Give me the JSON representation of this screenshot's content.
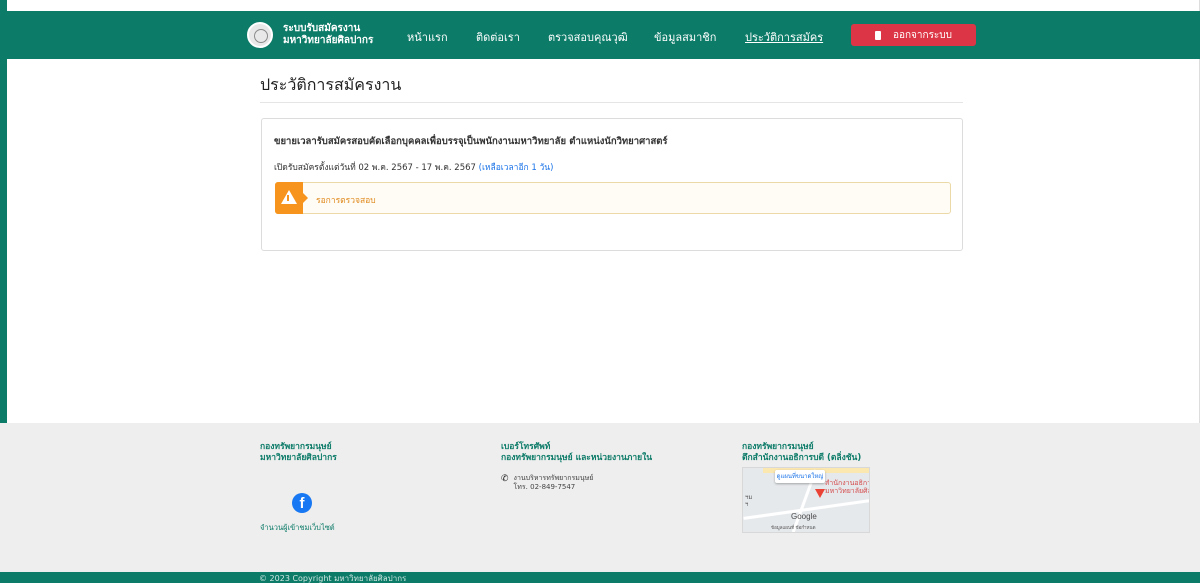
{
  "navbar": {
    "brand_line1": "ระบบรับสมัครงาน",
    "brand_line2": "มหาวิทยาลัยศิลปากร",
    "links": [
      "หน้าแรก",
      "ติดต่อเรา",
      "ตรวจสอบคุณวุฒิ",
      "ข้อมูลสมาชิก",
      "ประวัติการสมัคร"
    ],
    "active_link": "ประวัติการสมัคร",
    "logout_label": "ออกจากระบบ"
  },
  "main": {
    "page_title": "ประวัติการสมัครงาน",
    "application": {
      "title": "ขยายเวลารับสมัครสอบคัดเลือกบุคคลเพื่อบรรจุเป็นพนักงานมหาวิทยาลัย ตำแหน่งนักวิทยาศาสตร์",
      "date_text": "เปิดรับสมัครตั้งแต่วันที่ 02 พ.ค. 2567 - 17 พ.ค. 2567",
      "remaining": "(เหลือเวลาอีก 1 วัน)",
      "status": "รอการตรวจสอบ"
    }
  },
  "footer": {
    "col1": {
      "heading_line1": "กองทรัพยากรมนุษย์",
      "heading_line2": "มหาวิทยาลัยศิลปากร",
      "facebook_icon": "facebook-icon",
      "visitor_label": "จำนวนผู้เข้าชมเว็บไซต์"
    },
    "col2": {
      "heading_line1": "เบอร์โทรศัพท์",
      "heading_line2": "กองทรัพยากรมนุษย์ และหน่วยงานภายใน",
      "phone_name": "งานบริหารทรัพยากรมนุษย์",
      "phone_number": "โทร. 02-849-7547"
    },
    "col3": {
      "heading_line1": "กองทรัพยากรมนุษย์",
      "heading_line2": "ตึกสำนักงานอธิการบดี (ตลิ่งชัน)",
      "map_button": "ดูแผนที่ขนาดใหญ่",
      "map_place": "สำนักงานอธิการ",
      "map_place2": "มหาวิทยาลัยศิล",
      "map_brand": "Google",
      "map_footer": "ข้อมูลแผนที่   ข้อกำหนด"
    },
    "copyright": "© 2023 Copyright มหาวิทยาลัยศิลปากร"
  },
  "colors": {
    "primary": "#0c7b68",
    "danger": "#dc3545",
    "warning": "#f7941d",
    "link": "#1a73e8"
  }
}
